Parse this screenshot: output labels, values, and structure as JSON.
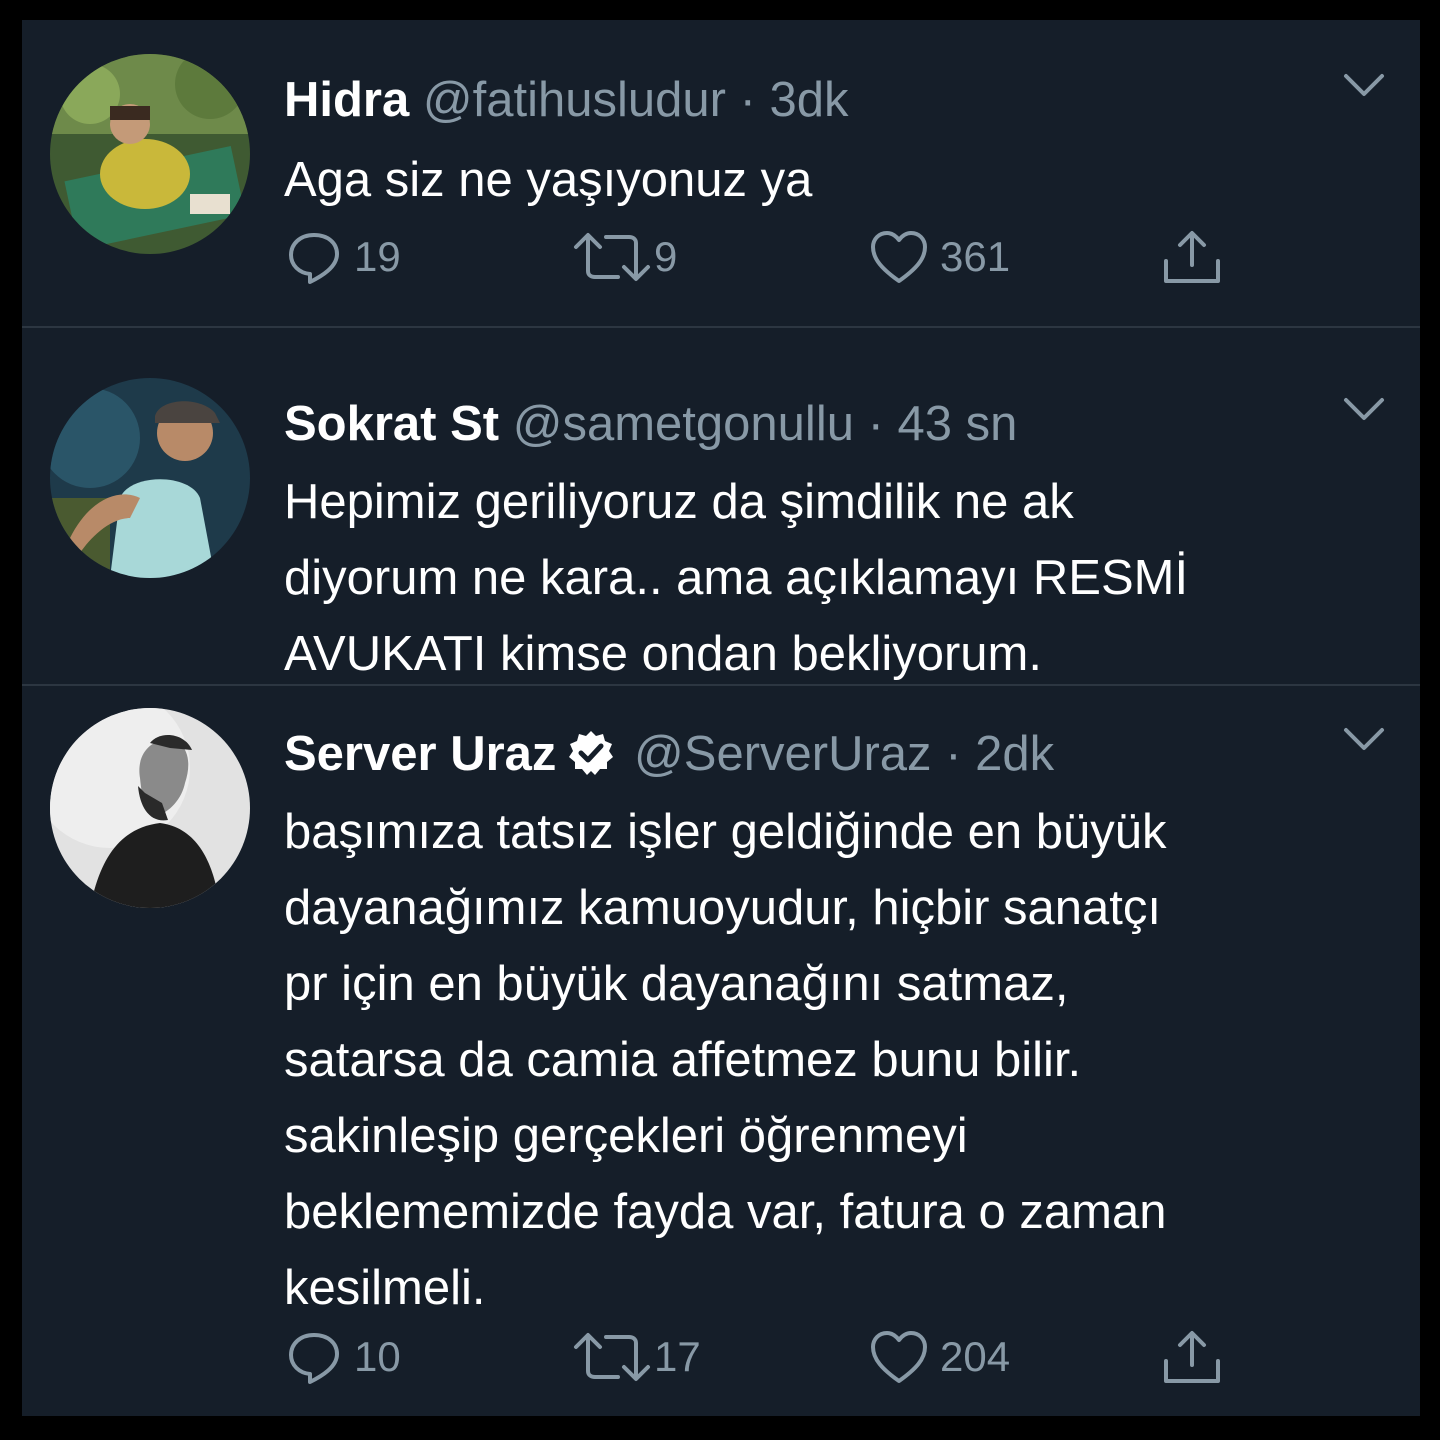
{
  "tweets": [
    {
      "name": "Hidra",
      "handle": "@fatihusludur",
      "separator": "·",
      "time": "3dk",
      "verified": false,
      "lines": [
        "Aga siz ne yaşıyonuz ya"
      ],
      "replies": "19",
      "retweets": "9",
      "likes": "361"
    },
    {
      "name": "Sokrat St",
      "handle": "@sametgonullu",
      "separator": "·",
      "time": "43 sn",
      "verified": false,
      "lines": [
        "Hepimiz geriliyoruz da şimdilik ne ak",
        "diyorum ne kara.. ama açıklamayı RESMİ",
        "AVUKATI kimse ondan bekliyorum."
      ]
    },
    {
      "name": "Server Uraz",
      "handle": "@ServerUraz",
      "separator": "·",
      "time": "2dk",
      "verified": true,
      "lines": [
        "başımıza tatsız işler geldiğinde en büyük",
        "dayanağımız kamuoyudur, hiçbir sanatçı",
        "pr için en büyük dayanağını satmaz,",
        "satarsa da camia affetmez bunu bilir.",
        "sakinleşip gerçekleri öğrenmeyi",
        "beklememizde fayda var, fatura o zaman",
        "kesilmeli."
      ],
      "replies": "10",
      "retweets": "17",
      "likes": "204"
    }
  ],
  "icons": {
    "reply": "reply-icon",
    "retweet": "retweet-icon",
    "like": "heart-icon",
    "share": "share-icon",
    "chevron": "chevron-down-icon",
    "verified": "verified-badge-icon"
  },
  "colors": {
    "background": "#151e29",
    "frame": "#000000",
    "text": "#ffffff",
    "secondary": "#8899a6",
    "divider": "#2c3641"
  }
}
